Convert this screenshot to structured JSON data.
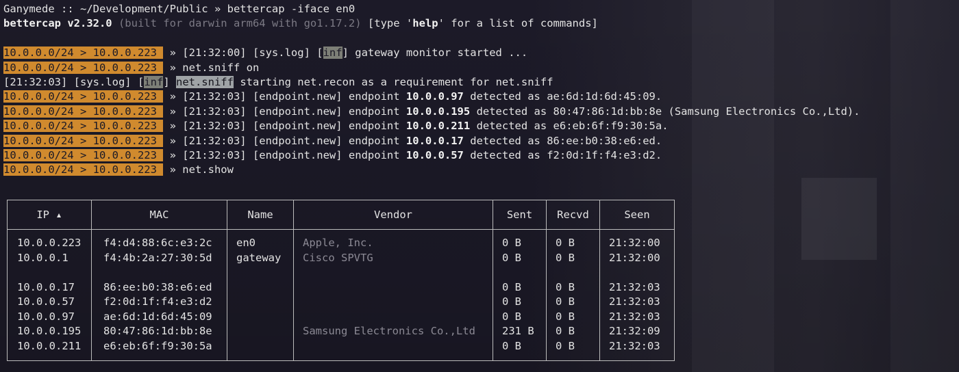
{
  "colors": {
    "prompt_bg": "#d08a2e",
    "background": "#1b1926",
    "table_border": "#bdbdbd"
  },
  "header": {
    "line1": "Ganymede :: ~/Development/Public » bettercap -iface en0",
    "version_bold": "bettercap v2.32.0",
    "version_build": " (built for darwin arm64 with go1.17.2)",
    "help_pre": " [type '",
    "help_word": "help",
    "help_post": "' for a list of commands]"
  },
  "prompt": "10.0.0.0/24 > 10.0.0.223 ",
  "log": [
    {
      "text": " » [21:32:00] [sys.log] [",
      "tag": "inf",
      "rest": "] gateway monitor started ..."
    },
    {
      "text": " » net.sniff on"
    },
    {
      "pre": "[21:32:03] [sys.log] [",
      "tag": "inf",
      "mid": "] ",
      "mod": "net.sniff",
      "rest": " starting net.recon as a requirement for net.sniff"
    },
    {
      "pre": " » [21:32:03] [endpoint.new] endpoint ",
      "ip": "10.0.0.97",
      "post": " detected as ae:6d:1d:6d:45:09."
    },
    {
      "pre": " » [21:32:03] [endpoint.new] endpoint ",
      "ip": "10.0.0.195",
      "post": " detected as 80:47:86:1d:bb:8e (Samsung Electronics Co.,Ltd)."
    },
    {
      "pre": " » [21:32:03] [endpoint.new] endpoint ",
      "ip": "10.0.0.211",
      "post": " detected as e6:eb:6f:f9:30:5a."
    },
    {
      "pre": " » [21:32:03] [endpoint.new] endpoint ",
      "ip": "10.0.0.17",
      "post": " detected as 86:ee:b0:38:e6:ed."
    },
    {
      "pre": " » [21:32:03] [endpoint.new] endpoint ",
      "ip": "10.0.0.57",
      "post": " detected as f2:0d:1f:f4:e3:d2."
    },
    {
      "text": " » net.show"
    }
  ],
  "table": {
    "headers": [
      "IP ▴",
      "MAC",
      "Name",
      "Vendor",
      "Sent",
      "Recvd",
      "Seen"
    ],
    "rows": [
      [
        "10.0.0.223",
        "f4:d4:88:6c:e3:2c",
        "en0",
        "Apple, Inc.",
        "0 B",
        "0 B",
        "21:32:00"
      ],
      [
        "10.0.0.1",
        "f4:4b:2a:27:30:5d",
        "gateway",
        "Cisco SPVTG",
        "0 B",
        "0 B",
        "21:32:00"
      ],
      [
        "10.0.0.17",
        "86:ee:b0:38:e6:ed",
        "",
        "",
        "0 B",
        "0 B",
        "21:32:03"
      ],
      [
        "10.0.0.57",
        "f2:0d:1f:f4:e3:d2",
        "",
        "",
        "0 B",
        "0 B",
        "21:32:03"
      ],
      [
        "10.0.0.97",
        "ae:6d:1d:6d:45:09",
        "",
        "",
        "0 B",
        "0 B",
        "21:32:03"
      ],
      [
        "10.0.0.195",
        "80:47:86:1d:bb:8e",
        "",
        "Samsung Electronics Co.,Ltd",
        "231 B",
        "0 B",
        "21:32:09"
      ],
      [
        "10.0.0.211",
        "e6:eb:6f:f9:30:5a",
        "",
        "",
        "0 B",
        "0 B",
        "21:32:03"
      ]
    ]
  }
}
